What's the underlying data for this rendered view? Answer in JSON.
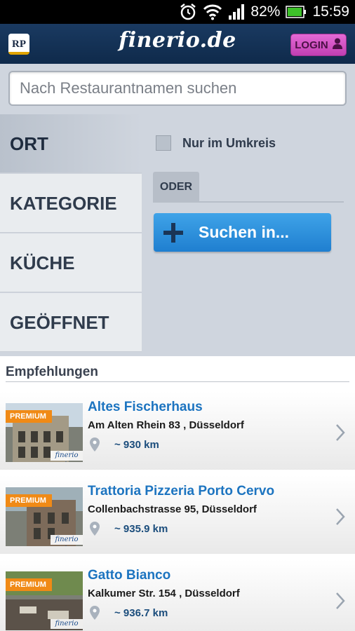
{
  "status_bar": {
    "battery": "82%",
    "time": "15:59"
  },
  "app_bar": {
    "badge": "RP",
    "brand": "finerio.de",
    "login_label": "LOGIN"
  },
  "search": {
    "placeholder": "Nach Restaurantnamen suchen"
  },
  "filters": {
    "tabs": [
      {
        "label": "ORT",
        "active": true
      },
      {
        "label": "KATEGORIE",
        "active": false
      },
      {
        "label": "KÜCHE",
        "active": false
      },
      {
        "label": "GEÖFFNET",
        "active": false
      }
    ],
    "radius_checkbox_label": "Nur im Umkreis",
    "radius_checked": false,
    "or_label": "ODER",
    "search_in_label": "Suchen in..."
  },
  "recommendations": {
    "title": "Empfehlungen",
    "premium_label": "PREMIUM",
    "watermark": "finerio de",
    "items": [
      {
        "name": "Altes Fischerhaus",
        "address": "Am Alten Rhein 83 , Düsseldorf",
        "distance": "~ 930 km"
      },
      {
        "name": "Trattoria Pizzeria Porto Cervo",
        "address": "Collenbachstrasse 95, Düsseldorf",
        "distance": "~ 935.9 km"
      },
      {
        "name": "Gatto Bianco",
        "address": "Kalkumer Str. 154 , Düsseldorf",
        "distance": "~ 936.7 km"
      }
    ]
  },
  "colors": {
    "accent_blue": "#2b8fde",
    "premium_orange": "#f08a16",
    "login_pink": "#d654c6",
    "header_navy": "#143358"
  }
}
